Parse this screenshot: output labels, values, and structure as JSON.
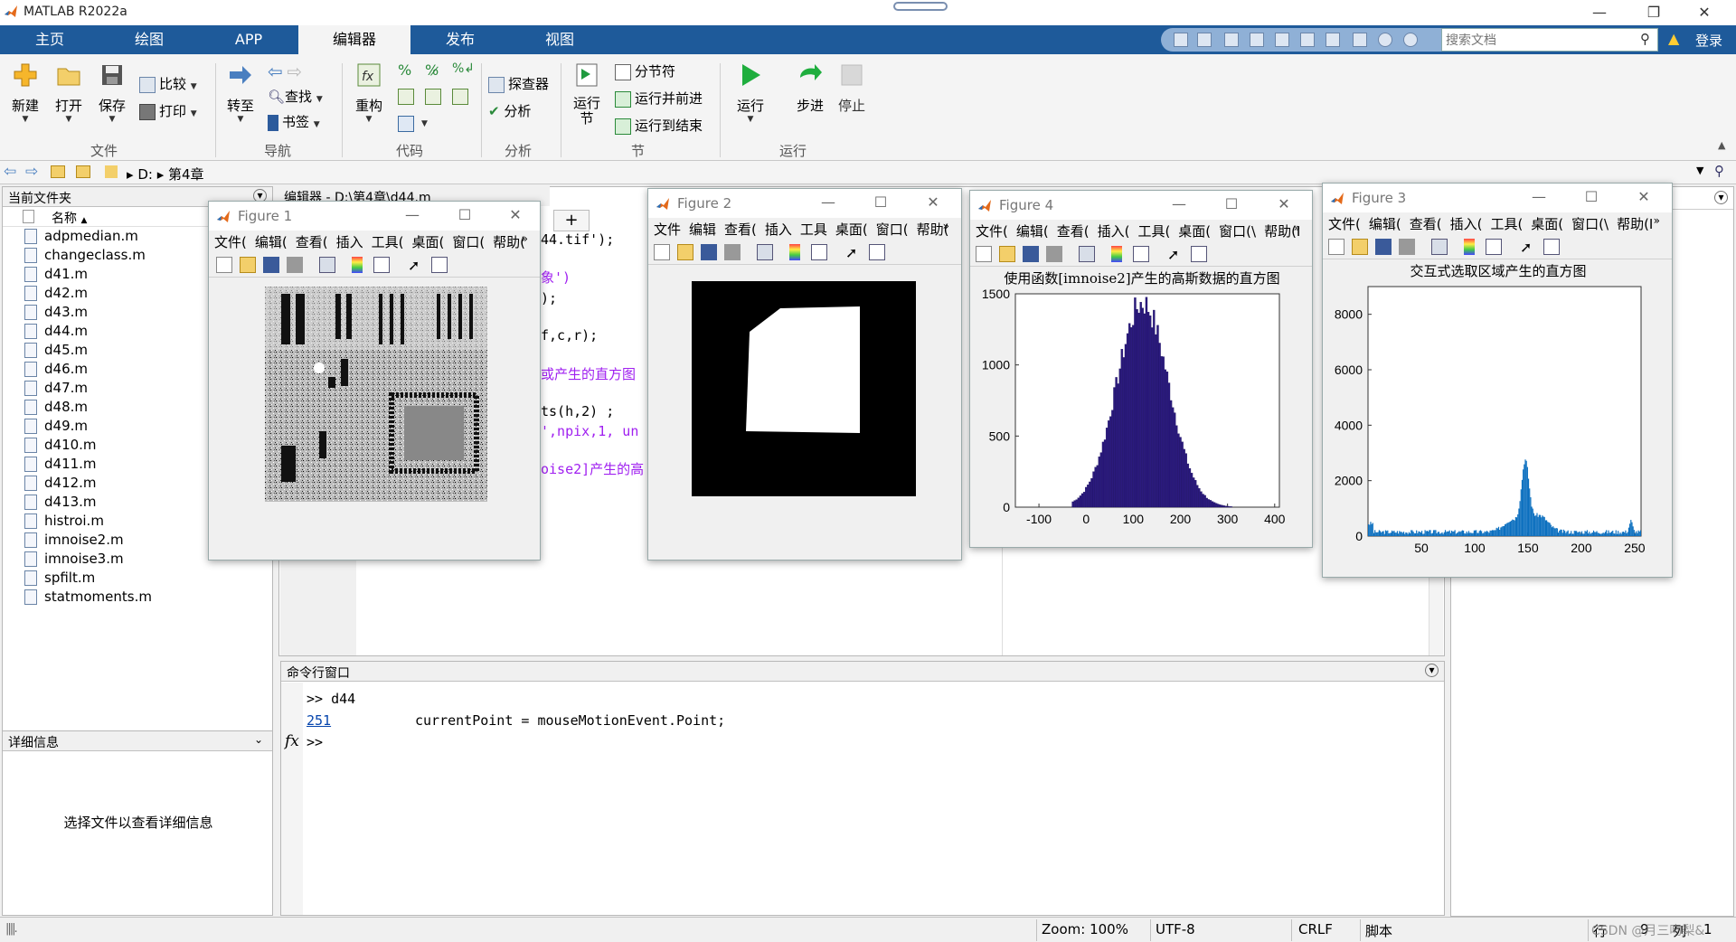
{
  "app": {
    "title": "MATLAB R2022a",
    "window_controls": [
      "—",
      "❐",
      "✕"
    ]
  },
  "tabs": [
    {
      "label": "主页"
    },
    {
      "label": "绘图"
    },
    {
      "label": "APP"
    },
    {
      "label": "编辑器",
      "active": true
    },
    {
      "label": "发布"
    },
    {
      "label": "视图"
    }
  ],
  "search": {
    "placeholder": "搜索文档"
  },
  "login_label": "登录",
  "ribbon": {
    "file": {
      "new": "新建",
      "open": "打开",
      "save": "保存",
      "compare": "比较",
      "print": "打印",
      "group": "文件"
    },
    "nav": {
      "goto": "转至",
      "find": "查找",
      "bookmark": "书签",
      "group": "导航"
    },
    "code": {
      "refactor": "重构",
      "group": "代码"
    },
    "analysis": {
      "explorer": "探查器",
      "analyze": "分析",
      "group": "分析"
    },
    "section": {
      "run_section": "运行\n节",
      "section_break": "分节符",
      "run_advance": "运行并前进",
      "run_to_end": "运行到结束",
      "group": "节"
    },
    "run": {
      "run": "运行",
      "step": "步进",
      "stop": "停止",
      "group": "运行"
    }
  },
  "address": {
    "drive": "D:",
    "folder": "第4章"
  },
  "current_folder": {
    "header": "当前文件夹",
    "col_name": "名称",
    "files": [
      "adpmedian.m",
      "changeclass.m",
      "d41.m",
      "d42.m",
      "d43.m",
      "d44.m",
      "d45.m",
      "d46.m",
      "d47.m",
      "d48.m",
      "d49.m",
      "d410.m",
      "d411.m",
      "d412.m",
      "d413.m",
      "histroi.m",
      "imnoise2.m",
      "imnoise3.m",
      "spfilt.m",
      "statmoments.m"
    ]
  },
  "details": {
    "header": "详细信息",
    "empty_text": "选择文件以查看详细信息"
  },
  "editor": {
    "header": "编辑器 - D:\\第4章\\d44.m",
    "visible_code": [
      "44.tif');",
      "象')",
      ");",
      "f,c,r);",
      "或产生的直方图",
      "ts(h,2) ;",
      "',npix,1, un",
      "oise2]产生的高"
    ]
  },
  "command_window": {
    "header": "命令行窗口",
    "lines": [
      ">> d44",
      "currentPoint = mouseMotionEvent.Point;"
    ],
    "link": "251",
    "prompt": ">>",
    "fx": "fx"
  },
  "statusbar": {
    "zoom": "Zoom: 100%",
    "encoding": "UTF-8",
    "eol": "CRLF",
    "type": "脚本",
    "row_label": "行",
    "row": "9",
    "col_label": "列",
    "col": "1",
    "watermark": "CSDN @月三吻梨&"
  },
  "figures": [
    {
      "title": "Figure 1",
      "menu": [
        "文件(",
        "编辑(",
        "查看(",
        "插入",
        "工具(",
        "桌面(",
        "窗口(",
        "帮助("
      ]
    },
    {
      "title": "Figure 2",
      "menu": [
        "文件",
        "编辑",
        "查看(",
        "插入",
        "工具",
        "桌面(",
        "窗口(",
        "帮助("
      ]
    },
    {
      "title": "Figure 4",
      "menu": [
        "文件(",
        "编辑(",
        "查看(",
        "插入(",
        "工具(",
        "桌面(",
        "窗口(\\",
        "帮助(I"
      ],
      "axes_title": "使用函数[imnoise2]产生的高斯数据的直方图"
    },
    {
      "title": "Figure 3",
      "menu": [
        "文件(",
        "编辑(",
        "查看(",
        "插入(",
        "工具(",
        "桌面(",
        "窗口(\\",
        "帮助(I"
      ],
      "axes_title": "交互式选取区域产生的直方图"
    }
  ],
  "colors": {
    "tabstrip": "#1e5a9a",
    "hist_fill": "#2b1a7e",
    "hist3_fill": "#0b6fbf"
  },
  "chart_data": [
    {
      "type": "bar",
      "title": "使用函数[imnoise2]产生的高斯数据的直方图",
      "xlim": [
        -150,
        410
      ],
      "ylim": [
        0,
        1500
      ],
      "xticks": [
        -100,
        0,
        100,
        200,
        300,
        400
      ],
      "yticks": [
        0,
        500,
        1000,
        1500
      ],
      "distribution": {
        "shape": "gaussian",
        "mean": 120,
        "std": 55,
        "peak": 1480,
        "range": [
          -30,
          310
        ]
      }
    },
    {
      "type": "area",
      "title": "交互式选取区域产生的直方图",
      "xlim": [
        0,
        256
      ],
      "ylim": [
        0,
        9000
      ],
      "xticks": [
        50,
        100,
        150,
        200,
        250
      ],
      "yticks": [
        0,
        2000,
        4000,
        6000,
        8000
      ],
      "peaks": [
        {
          "x": 147,
          "y": 2300
        },
        {
          "x": 135,
          "y": 450
        },
        {
          "x": 160,
          "y": 600
        },
        {
          "x": 246,
          "y": 400
        }
      ],
      "baseline": 150
    }
  ]
}
